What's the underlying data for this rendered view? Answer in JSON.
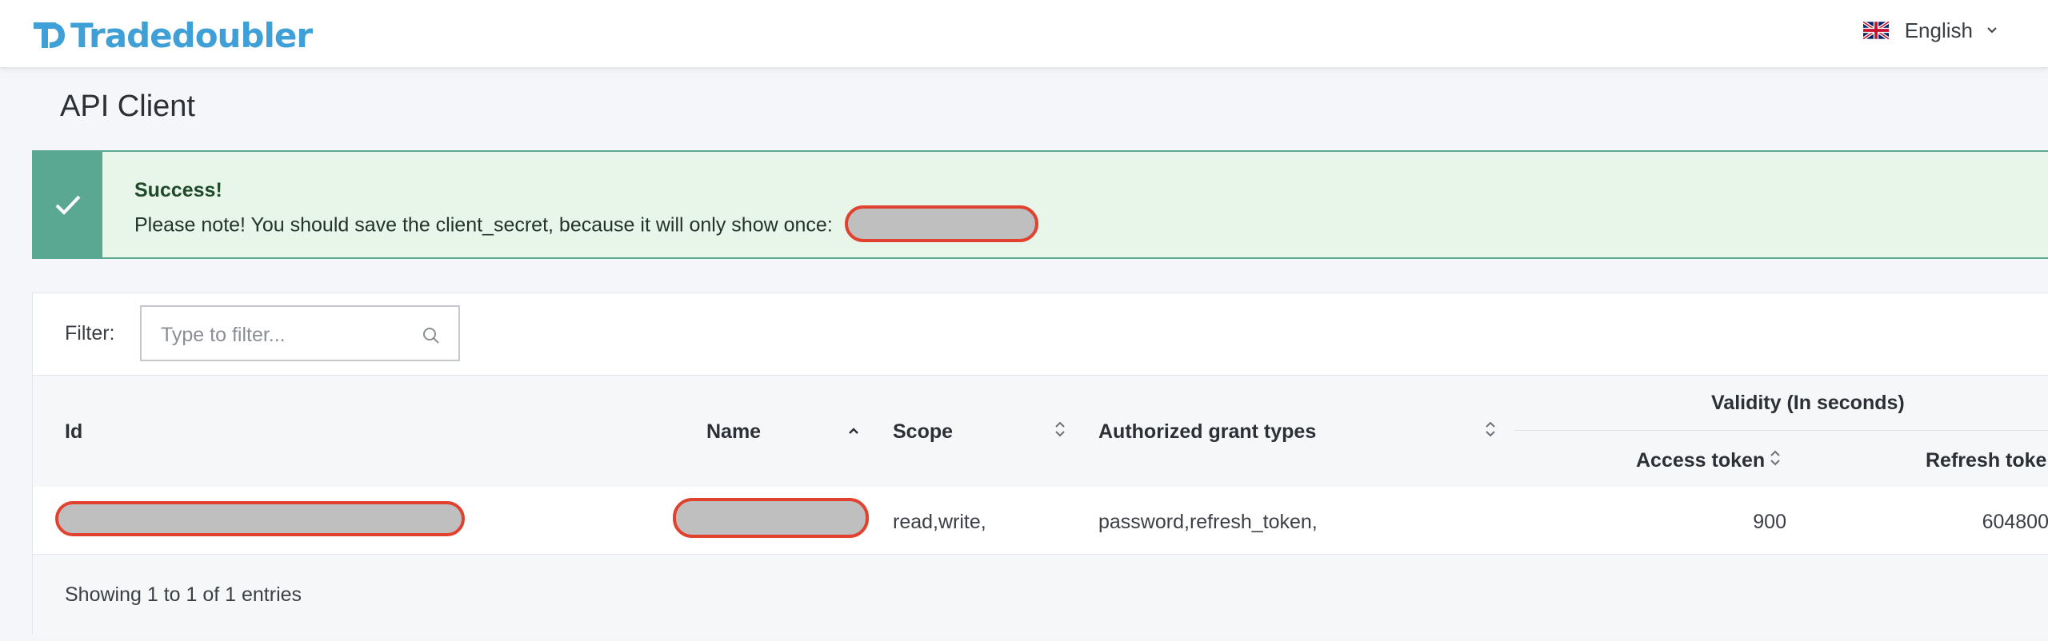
{
  "header": {
    "logo_text": "Tradedoubler",
    "language": {
      "label": "English",
      "flag_icon": "uk-flag-icon"
    }
  },
  "page": {
    "title": "API Client"
  },
  "alert": {
    "title": "Success!",
    "message": "Please note! You should save the client_secret, because it will only show once:",
    "icon": "check-icon",
    "color": "#5aa892"
  },
  "filter": {
    "label": "Filter:",
    "placeholder": "Type to filter...",
    "value": ""
  },
  "table": {
    "columns": {
      "id": "Id",
      "name": "Name",
      "scope": "Scope",
      "grant_types": "Authorized grant types",
      "validity_group": "Validity (In seconds)",
      "access_token": "Access token",
      "refresh_token": "Refresh token"
    },
    "rows": [
      {
        "scope": "read,write,",
        "grant_types": "password,refresh_token,",
        "access_token": "900",
        "refresh_token": "604800"
      }
    ],
    "footer": "Showing 1 to 1 of 1 entries"
  },
  "colors": {
    "brand": "#3ea0d6",
    "success_bg": "#e8f5e9",
    "success_accent": "#5aa892",
    "redaction_border": "#e0422f"
  }
}
